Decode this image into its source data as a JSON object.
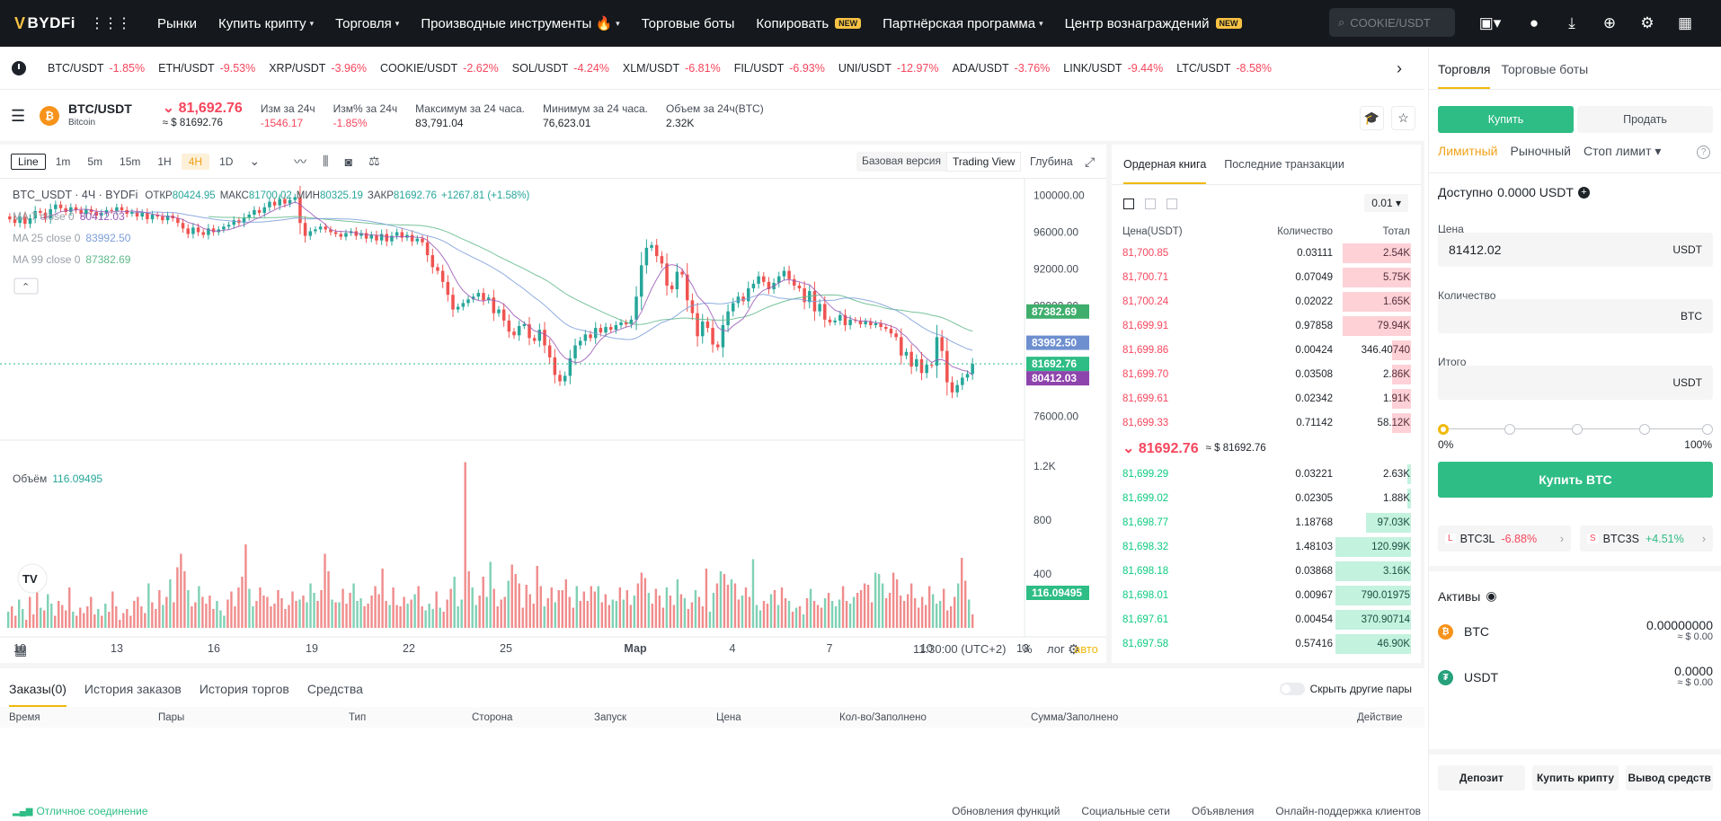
{
  "nav": {
    "logo": "BYDFi",
    "items": [
      {
        "label": "Рынки"
      },
      {
        "label": "Купить крипту",
        "caret": true
      },
      {
        "label": "Торговля",
        "caret": true
      },
      {
        "label": "Производные инструменты 🔥",
        "caret": true
      },
      {
        "label": "Торговые боты"
      },
      {
        "label": "Копировать",
        "badge": "NEW"
      },
      {
        "label": "Партнёрская программа",
        "caret": true
      },
      {
        "label": "Центр вознаграждений",
        "badge": "NEW"
      }
    ],
    "search_placeholder": "COOKIE/USDT"
  },
  "tickers": [
    {
      "pair": "BTC/USDT",
      "change": "-1.85%"
    },
    {
      "pair": "ETH/USDT",
      "change": "-9.53%"
    },
    {
      "pair": "XRP/USDT",
      "change": "-3.96%"
    },
    {
      "pair": "COOKIE/USDT",
      "change": "-2.62%"
    },
    {
      "pair": "SOL/USDT",
      "change": "-4.24%"
    },
    {
      "pair": "XLM/USDT",
      "change": "-6.81%"
    },
    {
      "pair": "FIL/USDT",
      "change": "-6.93%"
    },
    {
      "pair": "UNI/USDT",
      "change": "-12.97%"
    },
    {
      "pair": "ADA/USDT",
      "change": "-3.76%"
    },
    {
      "pair": "LINK/USDT",
      "change": "-9.44%"
    },
    {
      "pair": "LTC/USDT",
      "change": "-8.58%"
    }
  ],
  "pair": {
    "name": "BTC/USDT",
    "sub": "Bitcoin",
    "price": "81,692.76",
    "price_usd": "≈ $ 81692.76",
    "stats": [
      {
        "label": "Изм за 24ч",
        "value": "-1546.17",
        "red": true
      },
      {
        "label": "Изм% за 24ч",
        "value": "-1.85%",
        "red": true
      },
      {
        "label": "Максимум за 24 часа.",
        "value": "83,791.04"
      },
      {
        "label": "Минимум за 24 часа.",
        "value": "76,623.01"
      },
      {
        "label": "Объем за 24ч(BTC)",
        "value": "2.32K"
      }
    ]
  },
  "chart_tools": {
    "timeframes": [
      "Line",
      "1m",
      "5m",
      "15m",
      "1H",
      "4H",
      "1D"
    ],
    "active": "4H",
    "basic": "Базовая версия",
    "tradingview": "Trading View",
    "depth": "Глубина"
  },
  "chart_data": {
    "type": "candlestick",
    "title": "BTC_USDT · 4Ч · BYDFi",
    "ohlc_label": {
      "o": "80424.95",
      "h": "81700.02",
      "l": "80325.19",
      "c": "81692.76",
      "chg": "+1267.81 (+1.58%)"
    },
    "ma_labels": [
      {
        "name": "MA 7 close 0",
        "value": "80412.03",
        "color": "#9b59b6"
      },
      {
        "name": "MA 25 close 0",
        "value": "83992.50",
        "color": "#7b9ed9"
      },
      {
        "name": "MA 99 close 0",
        "value": "87382.69",
        "color": "#5fb98a"
      }
    ],
    "y_ticks": [
      "100000.00",
      "96000.00",
      "92000.00",
      "88000.00",
      "76000.00"
    ],
    "price_tags": [
      {
        "value": "87382.69",
        "color": "#3fae6c"
      },
      {
        "value": "83992.50",
        "color": "#6d8fcf"
      },
      {
        "value": "81692.76",
        "color": "#2ebd85"
      },
      {
        "value": "80412.03",
        "color": "#8e44ad"
      }
    ],
    "ylim": [
      74000,
      101800
    ],
    "x_ticks": [
      "10",
      "13",
      "16",
      "19",
      "22",
      "25",
      "Мар",
      "4",
      "7",
      "10",
      "13"
    ],
    "volume_label": "Объём",
    "volume_value": "116.09495",
    "volume_ticks": [
      "1.2K",
      "800",
      "400"
    ],
    "volume_tag": "116.09495",
    "close_series": [
      97400,
      97000,
      97700,
      96900,
      97500,
      98300,
      98100,
      97500,
      98500,
      99000,
      98600,
      98200,
      98700,
      98400,
      98000,
      98500,
      98200,
      97800,
      98100,
      98400,
      98300,
      98700,
      98400,
      98000,
      98200,
      97700,
      98100,
      97400,
      97900,
      97700,
      97300,
      97800,
      97500,
      97000,
      96400,
      95800,
      96500,
      96000,
      95700,
      96400,
      96000,
      96300,
      96600,
      96800,
      97300,
      97000,
      97600,
      97900,
      98400,
      98100,
      98700,
      99300,
      98900,
      99600,
      99100,
      99500,
      99800,
      97000,
      95600,
      96100,
      96300,
      96600,
      96300,
      96000,
      95800,
      95500,
      95900,
      96100,
      95600,
      95900,
      95300,
      95700,
      95100,
      95800,
      95000,
      95600,
      96000,
      95400,
      95700,
      95000,
      95300,
      94900,
      93500,
      92200,
      91800,
      90600,
      89200,
      87600,
      87900,
      88300,
      88700,
      89000,
      89400,
      88600,
      88900,
      87200,
      87600,
      86400,
      85200,
      84800,
      85800,
      86000,
      84500,
      84200,
      85400,
      83700,
      82400,
      80500,
      79800,
      80400,
      82300,
      83700,
      84200,
      84900,
      84500,
      85600,
      85100,
      85700,
      85400,
      85900,
      86200,
      86000,
      86500,
      89000,
      92400,
      94300,
      94600,
      93400,
      92600,
      90200,
      89800,
      91700,
      91400,
      88600,
      87200,
      84700,
      86300,
      85600,
      83800,
      83500,
      85900,
      87400,
      88300,
      89000,
      88500,
      89900,
      90400,
      91200,
      90600,
      89800,
      90500,
      91200,
      91800,
      90900,
      90200,
      89900,
      88400,
      89600,
      87400,
      88200,
      86500,
      86200,
      86400,
      87000,
      85900,
      86500,
      86400,
      86000,
      86300,
      85900,
      86100,
      85700,
      85500,
      85000,
      84600,
      82600,
      83000,
      81400,
      82200,
      80700,
      81600,
      81500,
      84600,
      83100,
      79700,
      78600,
      79400,
      80200,
      80600,
      81700
    ],
    "volumes": [
      120,
      160,
      90,
      210,
      140,
      60,
      230,
      100,
      330,
      150,
      130,
      250,
      180,
      90,
      200,
      170,
      130,
      300,
      120,
      90,
      150,
      110,
      160,
      230,
      100,
      140,
      90,
      180,
      120,
      270,
      160,
      60,
      110,
      140,
      90,
      200,
      230,
      160,
      110,
      330,
      190,
      140,
      280,
      170,
      230,
      360,
      190,
      450,
      550,
      420,
      280,
      160,
      190,
      310,
      230,
      180,
      240,
      140,
      200,
      130,
      90,
      210,
      270,
      160,
      300,
      380,
      620,
      290,
      160,
      200,
      300,
      240,
      230,
      160,
      180,
      280,
      220,
      140,
      170,
      270,
      200,
      210,
      240,
      190,
      330,
      260,
      200,
      280,
      550,
      420,
      210,
      190,
      190,
      290,
      180,
      260,
      330,
      200,
      220,
      160,
      180,
      240,
      310,
      250,
      440,
      200,
      170,
      300,
      170,
      160,
      230,
      180,
      210,
      250,
      310,
      160,
      130,
      180,
      140,
      270,
      150,
      120,
      210,
      290,
      380,
      160,
      210,
      1230,
      420,
      300,
      170,
      240,
      380,
      230,
      490,
      290,
      160,
      210,
      230,
      350,
      470,
      400,
      330,
      150,
      320,
      250,
      180,
      460,
      310,
      160,
      220,
      300,
      190,
      280,
      280,
      360,
      230,
      150,
      310,
      200,
      270,
      200,
      310,
      270,
      310,
      190,
      250,
      170,
      210,
      200,
      300,
      210,
      280,
      170,
      240,
      330,
      410,
      370,
      260,
      180,
      290,
      240,
      150,
      300,
      240,
      170,
      360,
      250,
      220,
      140,
      190,
      280,
      230,
      160,
      440,
      120,
      260,
      330,
      420,
      400,
      320,
      360,
      330,
      210,
      240,
      300,
      230,
      510,
      170,
      130,
      200,
      180,
      250,
      280,
      170,
      300,
      220,
      200,
      120,
      150,
      160,
      100,
      220,
      290,
      200,
      170,
      150,
      220,
      260,
      200,
      160,
      210,
      310,
      200,
      180,
      230,
      260,
      280,
      330,
      320,
      190,
      410,
      400,
      330,
      220,
      260,
      410,
      360,
      240,
      200,
      250,
      330,
      220,
      150,
      230,
      170,
      310,
      250,
      180,
      200,
      290,
      130,
      160,
      230,
      330,
      520,
      350,
      210,
      100
    ],
    "time_label": "11:30:00 (UTC+2)",
    "scale_opts": [
      "%",
      "лог",
      "авто"
    ]
  },
  "orderbook": {
    "tabs": [
      "Ордерная книга",
      "Последние транзакции"
    ],
    "precision": "0.01",
    "headers": [
      "Цена(USDT)",
      "Количество",
      "Тотал"
    ],
    "asks": [
      {
        "p": "81,700.85",
        "q": "0.03111",
        "t": "2.54K",
        "w": 0.9
      },
      {
        "p": "81,700.71",
        "q": "0.07049",
        "t": "5.75K",
        "w": 0.9
      },
      {
        "p": "81,700.24",
        "q": "0.02022",
        "t": "1.65K",
        "w": 0.9
      },
      {
        "p": "81,699.91",
        "q": "0.97858",
        "t": "79.94K",
        "w": 0.9
      },
      {
        "p": "81,699.86",
        "q": "0.00424",
        "t": "346.40740",
        "w": 0.25
      },
      {
        "p": "81,699.70",
        "q": "0.03508",
        "t": "2.86K",
        "w": 0.25
      },
      {
        "p": "81,699.61",
        "q": "0.02342",
        "t": "1.91K",
        "w": 0.25
      },
      {
        "p": "81,699.33",
        "q": "0.71142",
        "t": "58.12K",
        "w": 0.25
      }
    ],
    "mid_price": "81692.76",
    "mid_usd": "≈ $ 81692.76",
    "bids": [
      {
        "p": "81,699.29",
        "q": "0.03221",
        "t": "2.63K",
        "w": 0.05
      },
      {
        "p": "81,699.02",
        "q": "0.02305",
        "t": "1.88K",
        "w": 0.05
      },
      {
        "p": "81,698.77",
        "q": "1.18768",
        "t": "97.03K",
        "w": 0.6
      },
      {
        "p": "81,698.32",
        "q": "1.48103",
        "t": "120.99K",
        "w": 1.0
      },
      {
        "p": "81,698.18",
        "q": "0.03868",
        "t": "3.16K",
        "w": 1.0
      },
      {
        "p": "81,698.01",
        "q": "0.00967",
        "t": "790.01975",
        "w": 1.0
      },
      {
        "p": "81,697.61",
        "q": "0.00454",
        "t": "370.90714",
        "w": 1.0
      },
      {
        "p": "81,697.58",
        "q": "0.57416",
        "t": "46.90K",
        "w": 1.0
      }
    ]
  },
  "trade": {
    "tabs": [
      "Торговля",
      "Торговые боты"
    ],
    "buy": "Купить",
    "sell": "Продать",
    "order_types": [
      "Лимитный",
      "Рыночный",
      "Стоп лимит"
    ],
    "available_label": "Доступно",
    "available_value": "0.0000 USDT",
    "price_label": "Цена",
    "price_value": "81412.02",
    "price_unit": "USDT",
    "qty_label": "Количество",
    "qty_unit": "BTC",
    "total_label": "Итого",
    "total_unit": "USDT",
    "slider_min": "0%",
    "slider_max": "100%",
    "slider_level": 0,
    "buy_button": "Купить BTC",
    "leveraged": [
      {
        "tag": "L",
        "name": "BTC3L",
        "change": "-6.88%",
        "color": "#f6465d"
      },
      {
        "tag": "S",
        "name": "BTC3S",
        "change": "+4.51%",
        "color": "#2ebd85"
      }
    ],
    "assets_label": "Активы",
    "assets": [
      {
        "coin": "BTC",
        "amount": "0.00000000",
        "usd": "≈ $ 0.00",
        "color": "#f7931a"
      },
      {
        "coin": "USDT",
        "amount": "0.0000",
        "usd": "≈ $ 0.00",
        "color": "#26a17b"
      }
    ],
    "actions": [
      "Депозит",
      "Купить крипту",
      "Вывод средств"
    ]
  },
  "orders": {
    "tabs": [
      "Заказы(0)",
      "История заказов",
      "История торгов",
      "Средства"
    ],
    "hide_pairs": "Скрыть другие пары",
    "columns": [
      "Время",
      "Пары",
      "Тип",
      "Сторона",
      "Запуск",
      "Цена",
      "Кол-во/Заполнено",
      "Сумма/Заполнено",
      "Действие"
    ]
  },
  "footer": {
    "connection": "Отличное соединение",
    "links": [
      "Обновления функций",
      "Социальные сети",
      "Объявления",
      "Онлайн-поддержка клиентов"
    ]
  }
}
